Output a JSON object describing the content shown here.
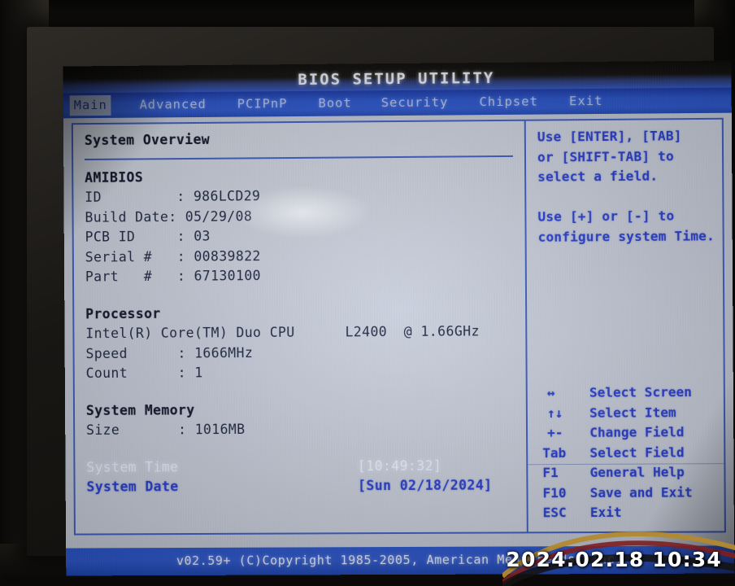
{
  "title": "BIOS SETUP UTILITY",
  "menu": {
    "items": [
      {
        "label": "Main",
        "active": true
      },
      {
        "label": "Advanced",
        "active": false
      },
      {
        "label": "PCIPnP",
        "active": false
      },
      {
        "label": "Boot",
        "active": false
      },
      {
        "label": "Security",
        "active": false
      },
      {
        "label": "Chipset",
        "active": false
      },
      {
        "label": "Exit",
        "active": false
      }
    ]
  },
  "main": {
    "page_title": "System Overview",
    "amibios": {
      "heading": "AMIBIOS",
      "rows": [
        {
          "label": "ID         : ",
          "value": "986LCD29"
        },
        {
          "label": "Build Date: ",
          "value": "05/29/08"
        },
        {
          "label": "PCB ID     : ",
          "value": "03"
        },
        {
          "label": "Serial #   : ",
          "value": "00839822"
        },
        {
          "label": "Part   #   : ",
          "value": "67130100"
        }
      ]
    },
    "processor": {
      "heading": "Processor",
      "model": "Intel(R) Core(TM) Duo CPU      L2400  @ 1.66GHz",
      "rows": [
        {
          "label": "Speed      : ",
          "value": "1666MHz"
        },
        {
          "label": "Count      : ",
          "value": "1"
        }
      ]
    },
    "memory": {
      "heading": "System Memory",
      "rows": [
        {
          "label": "Size       : ",
          "value": "1016MB"
        }
      ]
    },
    "time_row": {
      "label": "System Time",
      "value": "[10:49:32]",
      "selected": true
    },
    "date_row": {
      "label": "System Date",
      "value": "[Sun 02/18/2024]",
      "selected": false
    }
  },
  "help": {
    "text": "Use [ENTER], [TAB]\nor [SHIFT-TAB] to\nselect a field.\n\nUse [+] or [-] to\nconfigure system Time.",
    "legend": [
      {
        "key": "↔",
        "desc": "Select Screen"
      },
      {
        "key": "↑↓",
        "desc": "Select Item"
      },
      {
        "key": "+-",
        "desc": "Change Field"
      },
      {
        "key": "Tab",
        "desc": "Select Field"
      },
      {
        "key": "F1",
        "desc": "General Help"
      },
      {
        "key": "F10",
        "desc": "Save and Exit"
      },
      {
        "key": "ESC",
        "desc": "Exit"
      }
    ]
  },
  "footer": {
    "text": "v02.59+ (C)Copyright 1985-2005, American Megatrends, Inc."
  },
  "camera_overlay": {
    "timestamp": "2024.02.18  10:34"
  },
  "colors": {
    "menu_blue": "#2f59d0",
    "accent_blue": "#2b3fd0",
    "panel_bg": "#ced4e1",
    "border_blue": "#3f5fc8",
    "selected_text": "#f2f5ff"
  }
}
